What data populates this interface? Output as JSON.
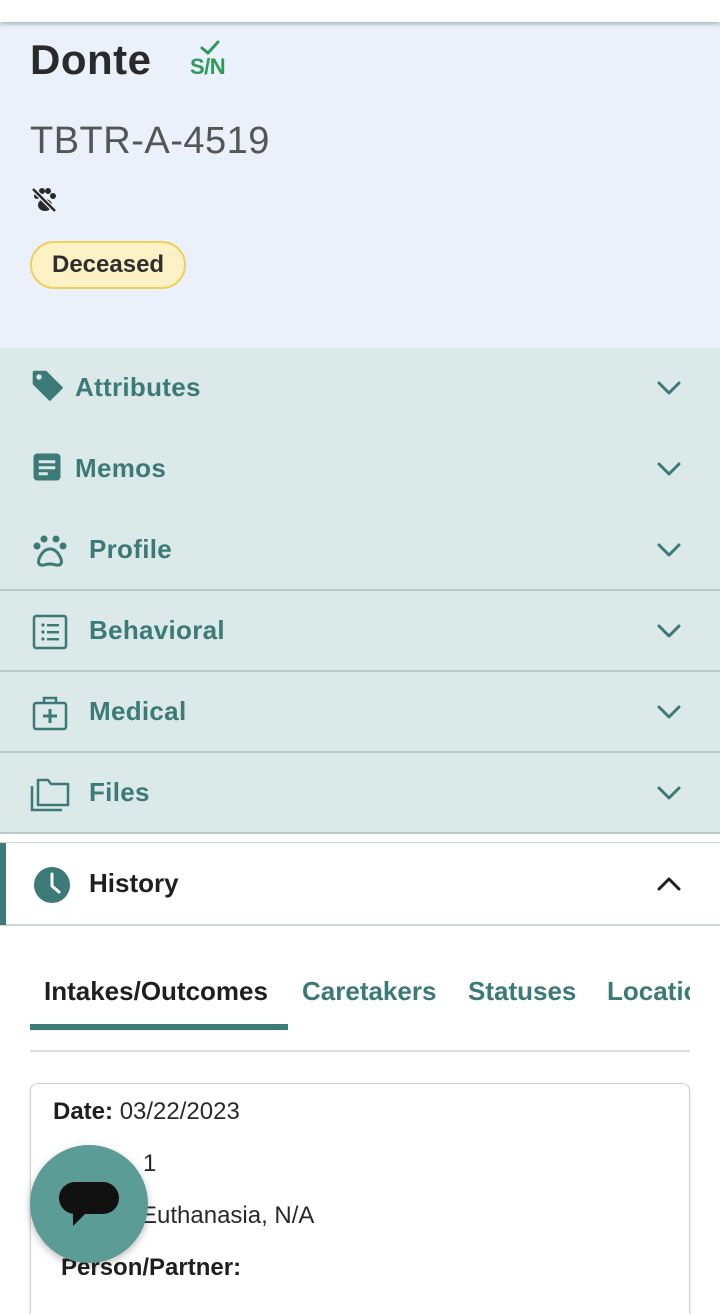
{
  "animal": {
    "name": "Donte",
    "spay_neuter_badge": "S/N",
    "id": "TBTR-A-4519",
    "status": "Deceased",
    "status_colors": {
      "background": "#fdf1c6",
      "border": "#f0cf5a"
    }
  },
  "sections": [
    {
      "label": "Attributes",
      "icon": "tag-icon"
    },
    {
      "label": "Memos",
      "icon": "memo-icon"
    },
    {
      "label": "Profile",
      "icon": "paw-icon"
    },
    {
      "label": "Behavioral",
      "icon": "list-icon"
    },
    {
      "label": "Medical",
      "icon": "medical-kit-icon"
    },
    {
      "label": "Files",
      "icon": "folders-icon"
    }
  ],
  "history": {
    "label": "History",
    "icon": "clock-icon",
    "tabs": [
      "Intakes/Outcomes",
      "Caretakers",
      "Statuses",
      "Locations"
    ],
    "active_tab": "Intakes/Outcomes"
  },
  "record": {
    "date_label": "Date:",
    "date_value": "03/22/2023",
    "partial_count": "1",
    "partial_outcome": "Euthanasia, N/A",
    "person_label": "Person/Partner:"
  },
  "colors": {
    "accent": "#3c7a78",
    "header_bg": "#eaf1fb",
    "section_bg": "#dce9e9",
    "sn_green": "#2e9a5a",
    "fab": "#5b9c97"
  },
  "chat_button": {
    "icon": "chat-bubble-icon"
  }
}
